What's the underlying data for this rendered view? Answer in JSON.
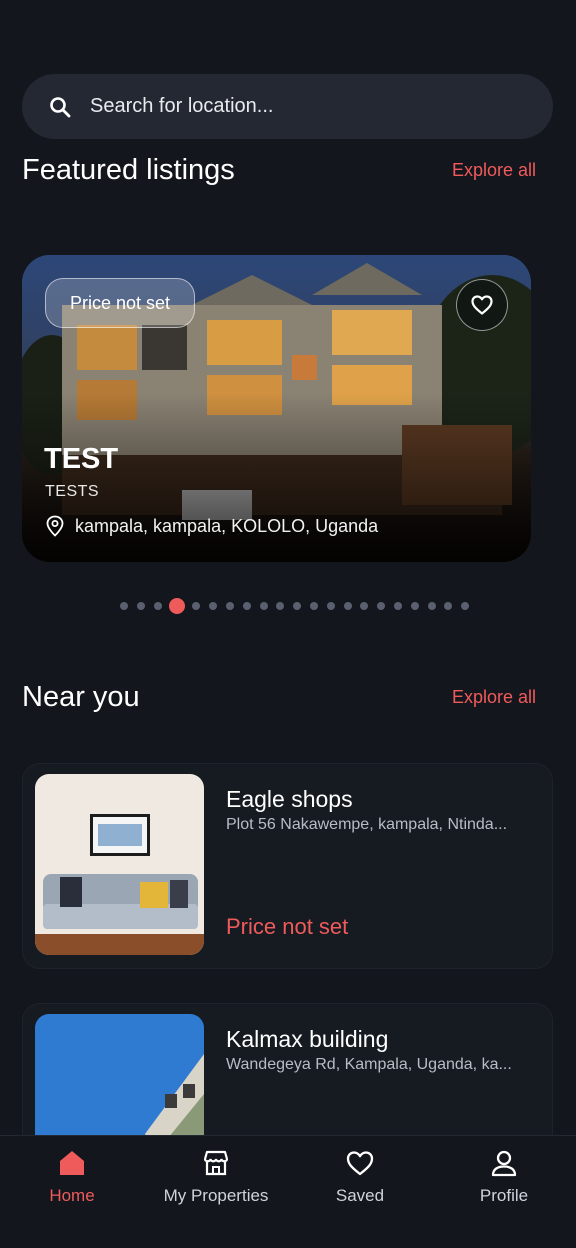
{
  "search": {
    "placeholder": "Search for location..."
  },
  "featured": {
    "title": "Featured listings",
    "explore_label": "Explore all",
    "card": {
      "price": "Price not set",
      "name": "TEST",
      "subtitle": "TESTS",
      "location": "kampala, kampala, KOLOLO, Uganda"
    },
    "pager": {
      "count": 21,
      "active_index": 3
    }
  },
  "near_you": {
    "title": "Near you",
    "explore_label": "Explore all",
    "items": [
      {
        "name": "Eagle shops",
        "address": "Plot 56 Nakawempe, kampala, Ntinda...",
        "price": "Price not set"
      },
      {
        "name": "Kalmax building",
        "address": "Wandegeya Rd, Kampala, Uganda, ka..."
      }
    ]
  },
  "nav": {
    "items": [
      {
        "label": "Home",
        "icon": "home-icon",
        "active": true
      },
      {
        "label": "My Properties",
        "icon": "store-icon"
      },
      {
        "label": "Saved",
        "icon": "heart-icon"
      },
      {
        "label": "Profile",
        "icon": "user-icon"
      }
    ]
  },
  "colors": {
    "accent": "#ef5b5b",
    "background": "#13161c",
    "surface": "#232833"
  }
}
